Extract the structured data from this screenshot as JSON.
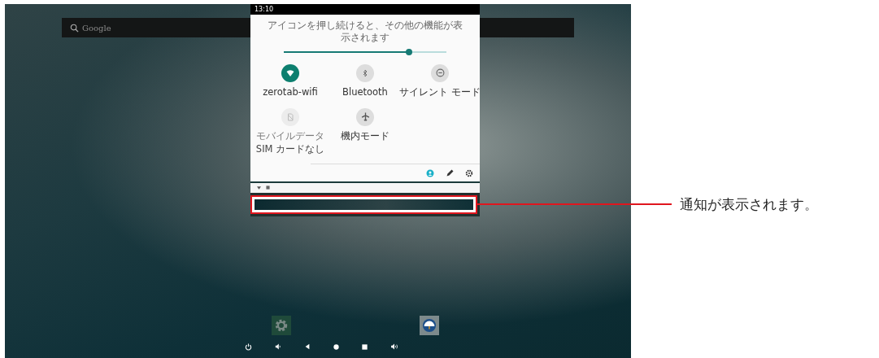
{
  "status_bar": {
    "time": "13:10"
  },
  "search": {
    "placeholder": "Google"
  },
  "quick_settings": {
    "hint": "アイコンを押し続けると、その他の機能が表示されます",
    "brightness": {
      "level": 0.77
    },
    "tiles": [
      {
        "kind": "wifi",
        "label": "zerotab-wifi",
        "on": true,
        "disabled": false
      },
      {
        "kind": "bluetooth",
        "label": "Bluetooth",
        "on": false,
        "disabled": false
      },
      {
        "kind": "silent",
        "label": "サイレント モード",
        "on": false,
        "disabled": false
      },
      {
        "kind": "mobile-data",
        "label": "モバイルデータ",
        "sublabel": "SIM カードなし",
        "on": false,
        "disabled": true
      },
      {
        "kind": "airplane",
        "label": "機内モード",
        "on": false,
        "disabled": false
      }
    ],
    "footer_icons": [
      {
        "kind": "user",
        "selected": true
      },
      {
        "kind": "edit",
        "selected": false
      },
      {
        "kind": "settings",
        "selected": false
      }
    ]
  },
  "notification": {
    "highlighted": true
  },
  "dock": [
    {
      "kind": "settings"
    },
    {
      "kind": "weather"
    }
  ],
  "nav_bar": [
    {
      "kind": "power"
    },
    {
      "kind": "volume-down"
    },
    {
      "kind": "back"
    },
    {
      "kind": "home"
    },
    {
      "kind": "recents"
    },
    {
      "kind": "volume-up"
    }
  ],
  "callout": {
    "text": "通知が表示されます。"
  }
}
